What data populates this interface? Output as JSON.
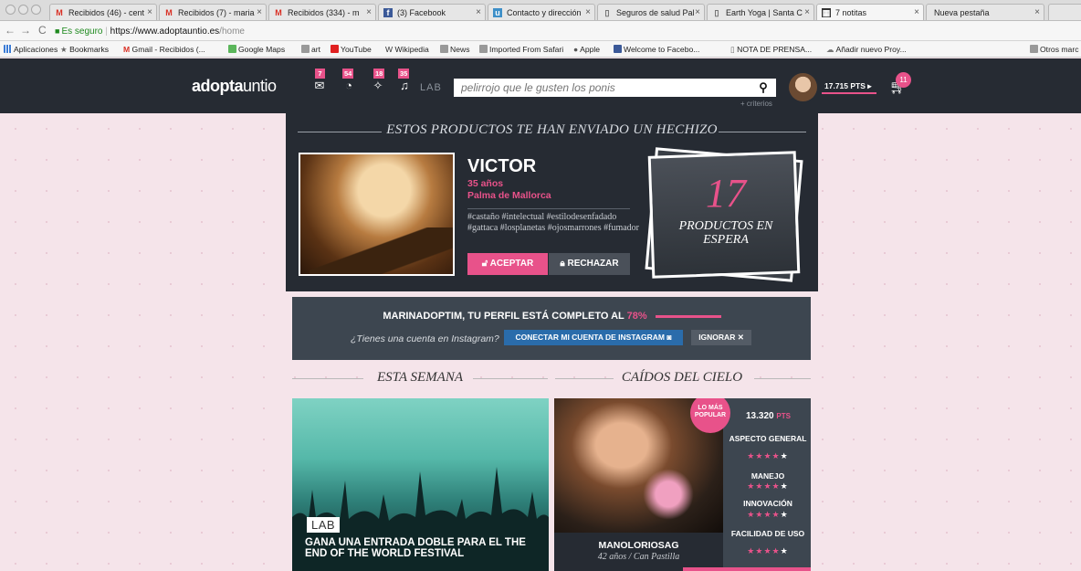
{
  "browser": {
    "tabs": [
      {
        "icon": "gmail-icon",
        "title": "Recibidos (46) - cent"
      },
      {
        "icon": "gmail-icon",
        "title": "Recibidos (7) - maria"
      },
      {
        "icon": "gmail-icon",
        "title": "Recibidos (334) - m"
      },
      {
        "icon": "facebook-icon",
        "title": "(3) Facebook"
      },
      {
        "icon": "site-icon",
        "title": "Contacto y dirección"
      },
      {
        "icon": "page-icon",
        "title": "Seguros de salud Pal"
      },
      {
        "icon": "page-icon",
        "title": "Earth Yoga | Santa C"
      },
      {
        "icon": "notes-icon",
        "title": "7 notitas"
      },
      {
        "icon": "none",
        "title": "Nueva pestaña"
      }
    ],
    "secure_label": "Es seguro",
    "url_host": "https://www.adoptauntio.es",
    "url_path": "/home",
    "bookmarks": [
      "Aplicaciones",
      "Bookmarks",
      "Gmail - Recibidos (...",
      "Google Maps",
      "art",
      "YouTube",
      "Wikipedia",
      "News",
      "Imported From Safari",
      "Apple",
      "Welcome to Facebo...",
      "NOTA DE PRENSA...",
      "Añadir nuevo Proy...",
      "Otros marc"
    ]
  },
  "header": {
    "logo_a": "adopta",
    "logo_b": "untio",
    "nav_badges": [
      "7",
      "54",
      "18",
      "35"
    ],
    "lab_label": "LAB",
    "search_placeholder": "pelirrojo que le gusten los ponis",
    "criterios": "+ criterios",
    "points": "17.715 PTS ▸",
    "cart_count": "11"
  },
  "hechizo": {
    "title": "ESTOS PRODUCTOS TE HAN ENVIADO UN HECHIZO",
    "name": "VICTOR",
    "age": "35 años",
    "city": "Palma de Mallorca",
    "tags": "#castaño #intelectual #estilodesenfadado #gattaca #losplanetas #ojosmarrones #fumador",
    "accept": "ACEPTAR",
    "reject": "RECHAZAR",
    "waiting_count": "17",
    "waiting_label": "PRODUCTOS EN ESPERA"
  },
  "profile": {
    "text": "MARINADOPTIM, TU PERFIL ESTÁ COMPLETO AL",
    "percent": "78%",
    "completion": 0.78,
    "question": "¿Tienes una cuenta en Instagram?",
    "connect": "CONECTAR MI CUENTA DE INSTAGRAM",
    "ignore": "IGNORAR ✕"
  },
  "sections": {
    "week": "ESTA SEMANA",
    "fallen": "CAÍDOS DEL CIELO"
  },
  "lab_card": {
    "tag": "LAB",
    "title": "GANA UNA ENTRADA DOBLE PARA EL THE END OF THE WORLD FESTIVAL"
  },
  "product": {
    "badge": "LO MÁS POPULAR",
    "name": "MANOLORIOSAG",
    "sub": "42 años / Can Pastilla",
    "points": "13.320",
    "points_unit": "PTS",
    "ratings": [
      {
        "label": "ASPECTO GENERAL",
        "stars": 4,
        "max": 5
      },
      {
        "label": "MANEJO",
        "stars": 4,
        "max": 5
      },
      {
        "label": "INNOVACIÓN",
        "stars": 4,
        "max": 5
      },
      {
        "label": "FACILIDAD DE USO",
        "stars": 4,
        "max": 5
      }
    ]
  },
  "colors": {
    "accent": "#e8528a",
    "dark": "#262b33",
    "panel": "#3d4650",
    "instagram_button": "#2a6cab"
  }
}
